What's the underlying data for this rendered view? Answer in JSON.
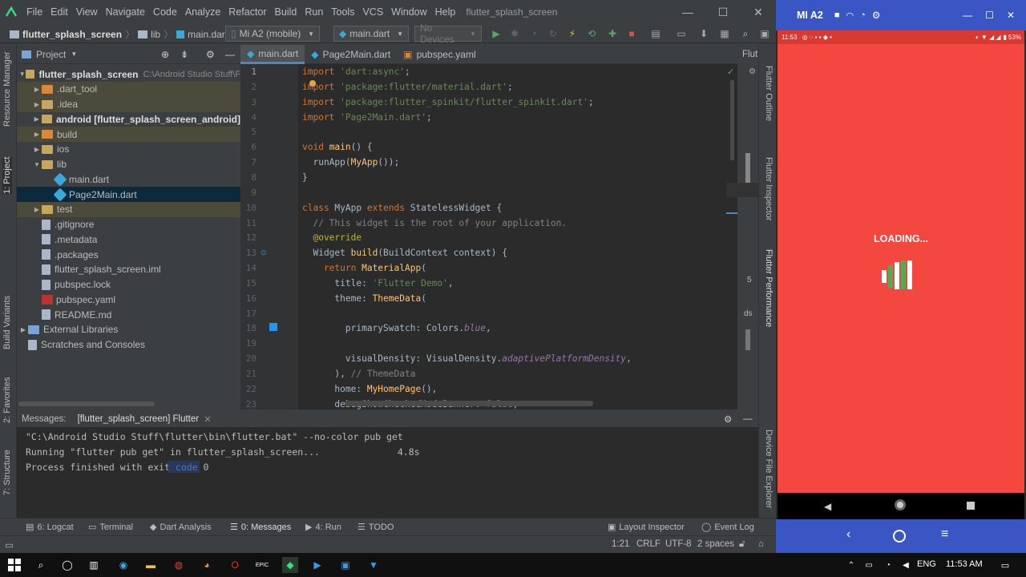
{
  "ide": {
    "menu": [
      "File",
      "Edit",
      "View",
      "Navigate",
      "Code",
      "Analyze",
      "Refactor",
      "Build",
      "Run",
      "Tools",
      "VCS",
      "Window",
      "Help"
    ],
    "window_title": "flutter_splash_screen",
    "breadcrumbs": [
      "flutter_splash_screen",
      "lib",
      "main.dart"
    ],
    "device_combo": "Mi A2 (mobile)",
    "run_config": "main.dart",
    "devices_combo": "No Devices",
    "project_panel_label": "Project",
    "left_strip": [
      "Resource Manager",
      "1: Project",
      "Build Variants",
      "2: Favorites",
      "7: Structure"
    ],
    "right_strip": [
      "Flutter Outline",
      "Flutter Inspector",
      "Flutter Performance",
      "Device File Explorer"
    ],
    "flutter_panel_title": "Flutt",
    "flutter_panel_nums": [
      "5",
      "ds"
    ],
    "tree": [
      {
        "label": "flutter_splash_screen",
        "suffix": "C:\\Android Studio Stuff\\F",
        "indent": 0,
        "arrow": "▼",
        "icon": "folder",
        "style": "root"
      },
      {
        "label": ".dart_tool",
        "indent": 1,
        "arrow": "▶",
        "icon": "folder-orange",
        "style": "excl"
      },
      {
        "label": ".idea",
        "indent": 1,
        "arrow": "▶",
        "icon": "folder",
        "style": "excl"
      },
      {
        "label": "android [flutter_splash_screen_android]",
        "indent": 1,
        "arrow": "▶",
        "icon": "folder",
        "style": "bold"
      },
      {
        "label": "build",
        "indent": 1,
        "arrow": "▶",
        "icon": "folder-orange",
        "style": "excl"
      },
      {
        "label": "ios",
        "indent": 1,
        "arrow": "▶",
        "icon": "folder",
        "style": ""
      },
      {
        "label": "lib",
        "indent": 1,
        "arrow": "▼",
        "icon": "folder",
        "style": ""
      },
      {
        "label": "main.dart",
        "indent": 2,
        "arrow": "",
        "icon": "dart",
        "style": ""
      },
      {
        "label": "Page2Main.dart",
        "indent": 2,
        "arrow": "",
        "icon": "dart",
        "style": "sel"
      },
      {
        "label": "test",
        "indent": 1,
        "arrow": "▶",
        "icon": "folder",
        "style": "excl"
      },
      {
        "label": ".gitignore",
        "indent": 1,
        "arrow": "",
        "icon": "file",
        "style": ""
      },
      {
        "label": ".metadata",
        "indent": 1,
        "arrow": "",
        "icon": "file",
        "style": ""
      },
      {
        "label": ".packages",
        "indent": 1,
        "arrow": "",
        "icon": "file",
        "style": ""
      },
      {
        "label": "flutter_splash_screen.iml",
        "indent": 1,
        "arrow": "",
        "icon": "file",
        "style": ""
      },
      {
        "label": "pubspec.lock",
        "indent": 1,
        "arrow": "",
        "icon": "file",
        "style": ""
      },
      {
        "label": "pubspec.yaml",
        "indent": 1,
        "arrow": "",
        "icon": "yaml",
        "style": ""
      },
      {
        "label": "README.md",
        "indent": 1,
        "arrow": "",
        "icon": "file",
        "style": ""
      },
      {
        "label": "External Libraries",
        "indent": 0,
        "arrow": "▶",
        "icon": "lib",
        "style": ""
      },
      {
        "label": "Scratches and Consoles",
        "indent": 0,
        "arrow": "",
        "icon": "scratch",
        "style": ""
      }
    ],
    "tabs": [
      "main.dart",
      "Page2Main.dart",
      "pubspec.yaml"
    ],
    "code_lines": [
      [
        [
          "kw",
          "import "
        ],
        [
          "str",
          "'dart:async'"
        ],
        [
          "",
          "; "
        ]
      ],
      [
        [
          "kw",
          "import "
        ],
        [
          "str",
          "'package:flutter/material.dart'"
        ],
        [
          "",
          ";"
        ]
      ],
      [
        [
          "kw",
          "import "
        ],
        [
          "str",
          "'package:flutter_spinkit/flutter_spinkit.dart'"
        ],
        [
          "",
          ";"
        ]
      ],
      [
        [
          "kw",
          "import "
        ],
        [
          "str",
          "'Page2Main.dart'"
        ],
        [
          "",
          ";"
        ]
      ],
      [],
      [
        [
          "kw",
          "void "
        ],
        [
          "fn",
          "main"
        ],
        [
          "",
          "() {"
        ]
      ],
      [
        [
          "",
          "  runApp("
        ],
        [
          "fn",
          "MyApp"
        ],
        [
          "",
          "());"
        ]
      ],
      [
        [
          "",
          "}"
        ]
      ],
      [],
      [
        [
          "kw",
          "class "
        ],
        [
          "",
          "MyApp "
        ],
        [
          "kw",
          "extends "
        ],
        [
          "",
          "StatelessWidget {"
        ]
      ],
      [
        [
          "cm",
          "  // This widget is the root of your application."
        ]
      ],
      [
        [
          "ann",
          "  @override"
        ]
      ],
      [
        [
          "",
          "  Widget "
        ],
        [
          "fn",
          "build"
        ],
        [
          "",
          "(BuildContext context) {"
        ]
      ],
      [
        [
          "kw",
          "    return "
        ],
        [
          "fn",
          "MaterialApp"
        ],
        [
          "",
          "("
        ]
      ],
      [
        [
          "",
          "      title: "
        ],
        [
          "str",
          "'Flutter Demo'"
        ],
        [
          "",
          ","
        ]
      ],
      [
        [
          "",
          "      theme: "
        ],
        [
          "fn",
          "ThemeData"
        ],
        [
          "",
          "("
        ]
      ],
      [],
      [
        [
          "",
          "        primarySwatch: Colors."
        ],
        [
          "it",
          "blue"
        ],
        [
          "",
          ","
        ]
      ],
      [],
      [
        [
          "",
          "        visualDensity: VisualDensity."
        ],
        [
          "it",
          "adaptivePlatformDensity"
        ],
        [
          "",
          ","
        ]
      ],
      [
        [
          "",
          "      ), "
        ],
        [
          "cm",
          "// ThemeData"
        ]
      ],
      [
        [
          "",
          "      home: "
        ],
        [
          "fn",
          "MyHomePage"
        ],
        [
          "",
          "(),"
        ]
      ],
      [
        [
          "",
          "      debugShowCheckedModeBanner: "
        ],
        [
          "kw",
          "false"
        ],
        [
          "",
          ","
        ]
      ]
    ],
    "messages_header": [
      "Messages:",
      "[flutter_splash_screen] Flutter"
    ],
    "messages": [
      "\"C:\\Android Studio Stuff\\flutter\\bin\\flutter.bat\" --no-color pub get",
      "Running \"flutter pub get\" in flutter_splash_screen...              4.8s",
      "Process finished with exit code 0"
    ],
    "bottom_tabs": [
      "6: Logcat",
      "Terminal",
      "Dart Analysis",
      "0: Messages",
      "4: Run",
      "TODO"
    ],
    "bottom_right_tabs": [
      "Layout Inspector",
      "Event Log"
    ],
    "status": {
      "position": "1:21",
      "line_sep": "CRLF",
      "encoding": "UTF-8",
      "indent": "2 spaces"
    }
  },
  "emulator": {
    "title": "MI A2",
    "status_time": "11:53",
    "battery": "53%",
    "loading_text": "LOADING...",
    "screen_color": "#f4473f"
  },
  "taskbar": {
    "lang": "ENG",
    "time": "11:53 AM"
  }
}
